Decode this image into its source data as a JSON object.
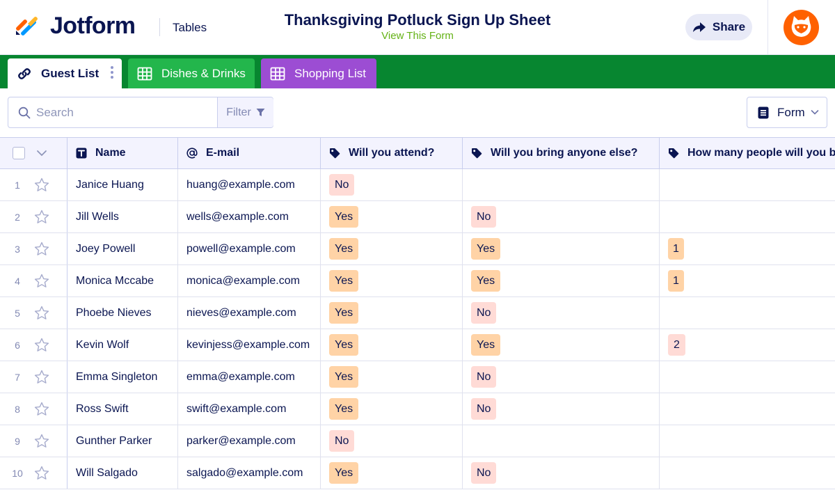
{
  "header": {
    "brand": "Jotform",
    "nav_link": "Tables",
    "form_title": "Thanksgiving Potluck Sign Up Sheet",
    "view_form_label": "View This Form",
    "share_label": "Share",
    "logo_icon": "jotform-logo-icon",
    "avatar_icon": "podo-cat-avatar-icon"
  },
  "tabs": [
    {
      "label": "Guest List",
      "icon": "link-icon",
      "active": true
    },
    {
      "label": "Dishes & Drinks",
      "icon": "table-grid-icon",
      "active": false
    },
    {
      "label": "Shopping List",
      "icon": "table-grid-icon",
      "active": false
    }
  ],
  "toolbar": {
    "search_placeholder": "Search",
    "filter_label": "Filter",
    "form_label": "Form"
  },
  "table": {
    "columns": [
      {
        "label": "Name",
        "icon": "text-type-icon"
      },
      {
        "label": "E-mail",
        "icon": "at-sign-icon"
      },
      {
        "label": "Will you attend?",
        "icon": "tag-icon"
      },
      {
        "label": "Will you bring anyone else?",
        "icon": "tag-icon"
      },
      {
        "label": "How many people will you bri",
        "icon": "tag-icon"
      }
    ],
    "rows": [
      {
        "num": "1",
        "name": "Janice Huang",
        "email": "huang@example.com",
        "attend": "No",
        "bring": "",
        "count": ""
      },
      {
        "num": "2",
        "name": "Jill Wells",
        "email": "wells@example.com",
        "attend": "Yes",
        "bring": "No",
        "count": ""
      },
      {
        "num": "3",
        "name": "Joey Powell",
        "email": "powell@example.com",
        "attend": "Yes",
        "bring": "Yes",
        "count": "1"
      },
      {
        "num": "4",
        "name": "Monica Mccabe",
        "email": "monica@example.com",
        "attend": "Yes",
        "bring": "Yes",
        "count": "1"
      },
      {
        "num": "5",
        "name": "Phoebe Nieves",
        "email": "nieves@example.com",
        "attend": "Yes",
        "bring": "No",
        "count": ""
      },
      {
        "num": "6",
        "name": "Kevin Wolf",
        "email": "kevinjess@example.com",
        "attend": "Yes",
        "bring": "Yes",
        "count": "2"
      },
      {
        "num": "7",
        "name": "Emma Singleton",
        "email": "emma@example.com",
        "attend": "Yes",
        "bring": "No",
        "count": ""
      },
      {
        "num": "8",
        "name": "Ross Swift",
        "email": "swift@example.com",
        "attend": "Yes",
        "bring": "No",
        "count": ""
      },
      {
        "num": "9",
        "name": "Gunther Parker",
        "email": "parker@example.com",
        "attend": "No",
        "bring": "",
        "count": ""
      },
      {
        "num": "10",
        "name": "Will Salgado",
        "email": "salgado@example.com",
        "attend": "Yes",
        "bring": "No",
        "count": ""
      }
    ]
  },
  "colors": {
    "navy": "#0a1551",
    "tab_bar_green": "#078630",
    "tab_dishes_green": "#23b64c",
    "tab_shopping_purple": "#9c4dd3",
    "view_form_green": "#64b215",
    "yes_tag": "#ffd3a6",
    "no_tag": "#ffdbd6",
    "avatar_orange": "#ff6100"
  }
}
